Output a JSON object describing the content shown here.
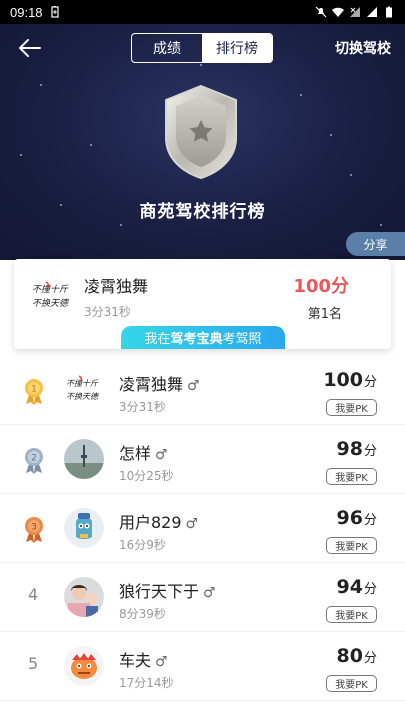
{
  "status_bar": {
    "time": "09:18"
  },
  "header": {
    "tabs": [
      {
        "label": "成绩",
        "active": false
      },
      {
        "label": "排行榜",
        "active": true
      }
    ],
    "switch_label": "切换驾校",
    "title": "商苑驾校排行榜"
  },
  "share_label": "分享",
  "my_card": {
    "name": "凌霄独舞",
    "time": "3分31秒",
    "score": "100分",
    "rank": "第1名",
    "promo_prefix": "我在",
    "promo_brand": "驾考宝典",
    "promo_suffix": "考驾照"
  },
  "leaderboard": [
    {
      "rank": "1",
      "name": "凌霄独舞",
      "gender": "♂",
      "time": "3分31秒",
      "score": "100",
      "unit": "分",
      "pk": "我要PK"
    },
    {
      "rank": "2",
      "name": "怎样",
      "gender": "♂",
      "time": "10分25秒",
      "score": "98",
      "unit": "分",
      "pk": "我要PK"
    },
    {
      "rank": "3",
      "name": "用户829",
      "gender": "♂",
      "time": "16分9秒",
      "score": "96",
      "unit": "分",
      "pk": "我要PK"
    },
    {
      "rank": "4",
      "name": "狼行天下于",
      "gender": "♂",
      "time": "8分39秒",
      "score": "94",
      "unit": "分",
      "pk": "我要PK"
    },
    {
      "rank": "5",
      "name": "车夫",
      "gender": "♂",
      "time": "17分14秒",
      "score": "80",
      "unit": "分",
      "pk": "我要PK"
    }
  ],
  "colors": {
    "hero_bg": "#1a1f42",
    "score_red": "#e8585a",
    "promo": "#2aa7ee",
    "gold": "#f0b43a",
    "silver": "#8aa0b8",
    "bronze": "#e07a3a"
  }
}
